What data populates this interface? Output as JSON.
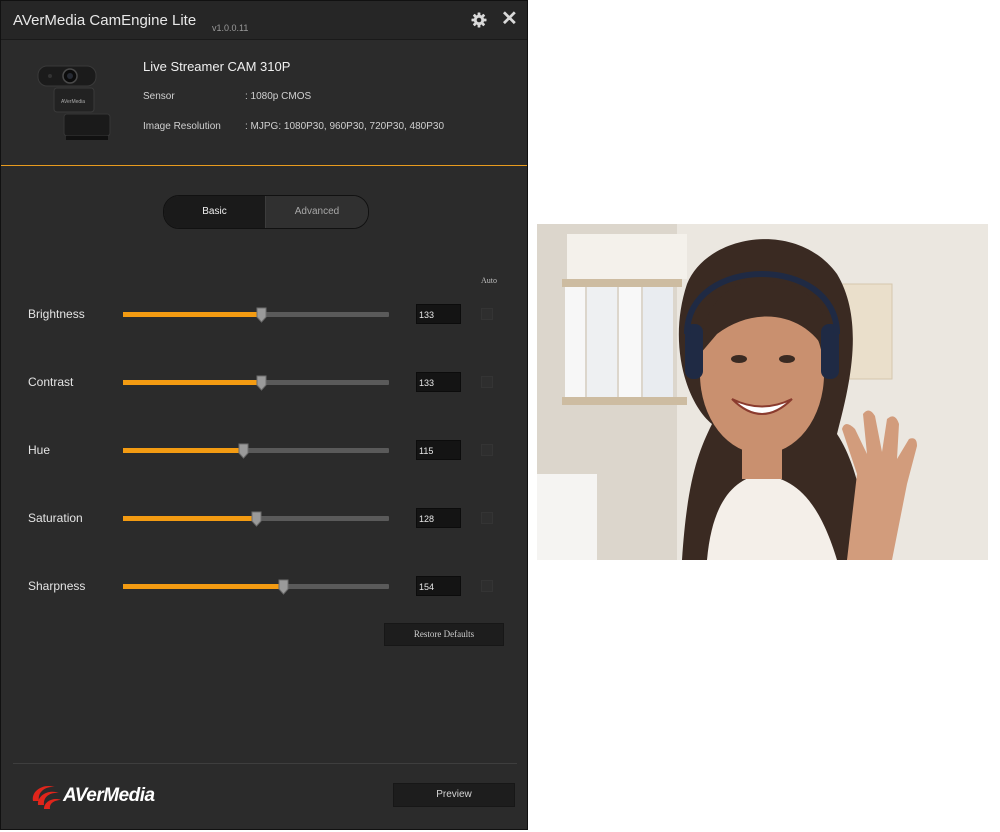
{
  "window": {
    "title": "AVerMedia CamEngine Lite",
    "version": "v1.0.0.11",
    "settings_icon": "gear-icon",
    "close_icon": "close-icon"
  },
  "device": {
    "name": "Live Streamer CAM 310P",
    "sensor_label": "Sensor",
    "sensor_value": ":   1080p CMOS",
    "resolution_label": "Image Resolution",
    "resolution_value": ":   MJPG: 1080P30, 960P30, 720P30, 480P30"
  },
  "tabs": {
    "basic": "Basic",
    "advanced": "Advanced",
    "active": "Basic"
  },
  "auto_header": "Auto",
  "controls": [
    {
      "label": "Brightness",
      "value": "133",
      "fraction": 0.52
    },
    {
      "label": "Contrast",
      "value": "133",
      "fraction": 0.52
    },
    {
      "label": "Hue",
      "value": "115",
      "fraction": 0.45
    },
    {
      "label": "Saturation",
      "value": "128",
      "fraction": 0.5
    },
    {
      "label": "Sharpness",
      "value": "154",
      "fraction": 0.6
    }
  ],
  "restore_label": "Restore Defaults",
  "preview_label": "Preview",
  "brand": "AVerMedia",
  "accent_color": "#f39b12"
}
